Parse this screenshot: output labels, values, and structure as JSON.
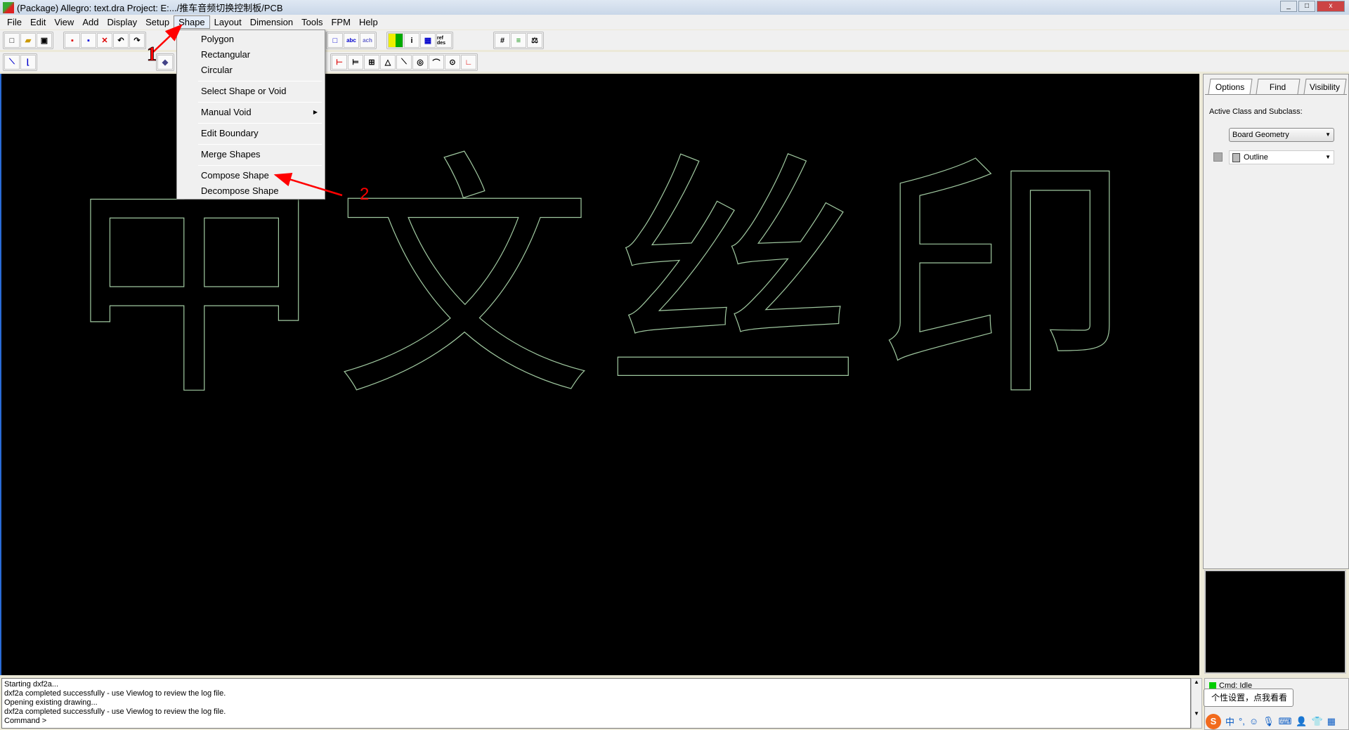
{
  "window": {
    "title": "(Package) Allegro: text.dra  Project: E:.../推车音频切换控制板/PCB"
  },
  "menubar": [
    "File",
    "Edit",
    "View",
    "Add",
    "Display",
    "Setup",
    "Shape",
    "Layout",
    "Dimension",
    "Tools",
    "FPM",
    "Help"
  ],
  "active_menu": "Shape",
  "shape_menu": {
    "items": [
      {
        "label": "Polygon"
      },
      {
        "label": "Rectangular"
      },
      {
        "label": "Circular"
      },
      {
        "label": "Select Shape or Void"
      },
      {
        "label": "Manual Void",
        "submenu": true
      },
      {
        "label": "Edit Boundary"
      },
      {
        "label": "Merge Shapes"
      },
      {
        "label": "Compose Shape",
        "highlighted_by_annotation": true
      },
      {
        "label": "Decompose Shape"
      }
    ]
  },
  "toolbar": {
    "icons": [
      "new-icon",
      "open-icon",
      "save-icon",
      "move-icon",
      "copy-icon",
      "delete-icon",
      "undo-icon",
      "redo-icon",
      "rectangle-icon",
      "text-abc-icon",
      "text-edit-icon",
      "color-icon",
      "info-icon",
      "grid-layers-icon",
      "refdes-icon",
      "grid-icon",
      "layers-icon",
      "balance-icon"
    ],
    "labels": {
      "abc": "abc",
      "ach": "ach",
      "info": "i",
      "ref": "ref des",
      "grid": "#"
    }
  },
  "canvas": {
    "background": "#000000",
    "stroke_color": "#9fc79f",
    "drawn_text": "中文丝印"
  },
  "right_panel": {
    "tabs": [
      "Options",
      "Find",
      "Visibility"
    ],
    "active_tab": "Options",
    "active_class_label": "Active Class and Subclass:",
    "class_value": "Board Geometry",
    "subclass_value": "Outline"
  },
  "console": {
    "lines": [
      "Starting dxf2a...",
      "dxf2a completed successfully - use Viewlog to review the log file.",
      "Opening existing drawing...",
      "dxf2a completed successfully - use Viewlog to review the log file.",
      "Command >"
    ]
  },
  "status": {
    "text": "Cmd: Idle",
    "indicator_color": "#00cc00"
  },
  "ime": {
    "tooltip": "个性设置，点我看看",
    "logo": "S",
    "mode": "中",
    "punct": "°,"
  },
  "annotations": {
    "step1": "1",
    "step2": "2",
    "color": "#ff0000"
  }
}
